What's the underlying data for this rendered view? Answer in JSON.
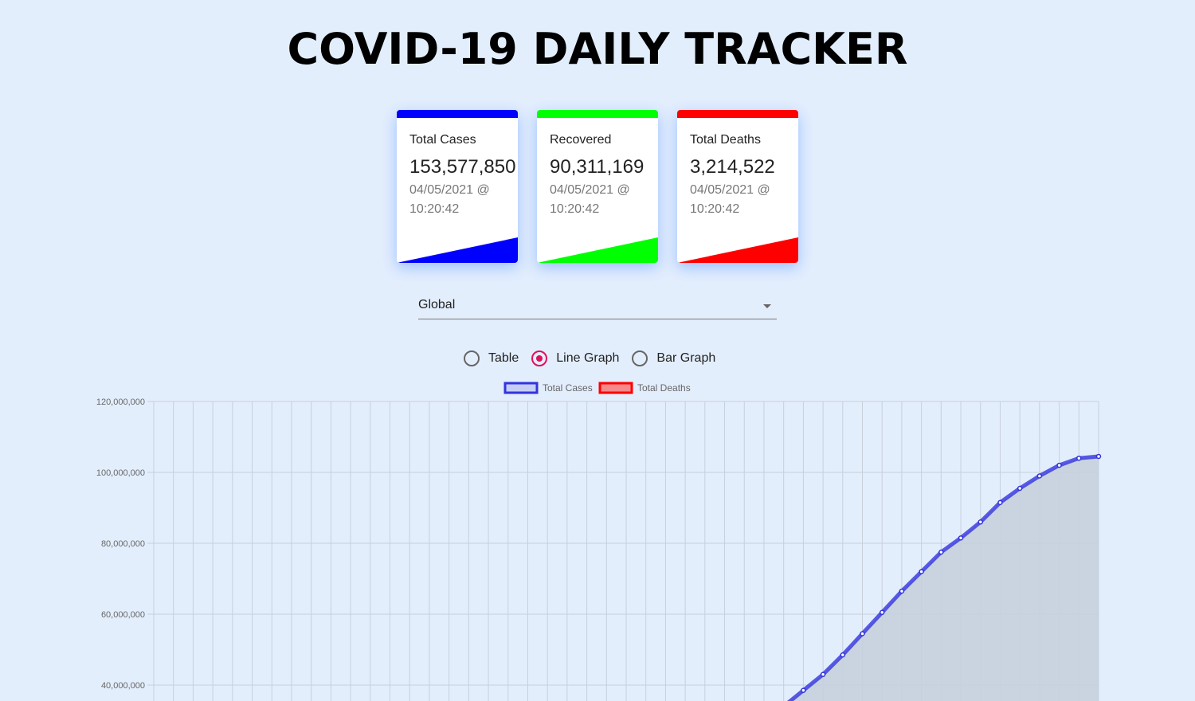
{
  "header": {
    "title": "COVID-19 DAILY TRACKER"
  },
  "cards": [
    {
      "label": "Total Cases",
      "value": "153,577,850",
      "date": "04/05/2021 @",
      "time": "10:20:42",
      "color": "#0000ff"
    },
    {
      "label": "Recovered",
      "value": "90,311,169",
      "date": "04/05/2021 @",
      "time": "10:20:42",
      "color": "#00ff00"
    },
    {
      "label": "Total Deaths",
      "value": "3,214,522",
      "date": "04/05/2021 @",
      "time": "10:20:42",
      "color": "#ff0000"
    }
  ],
  "country_select": {
    "value": "Global",
    "icon": "chevron-down-icon"
  },
  "view_options": {
    "options": [
      "Table",
      "Line Graph",
      "Bar Graph"
    ],
    "selected": "Line Graph",
    "accent": "#e0105a"
  },
  "chart_data": {
    "type": "line",
    "legend": [
      {
        "name": "Total Cases",
        "color": "#3333dd"
      },
      {
        "name": "Total Deaths",
        "color": "#ff0000"
      }
    ],
    "legend_position": "top-center",
    "yticks": [
      "120,000,000",
      "100,000,000",
      "80,000,000",
      "60,000,000",
      "40,000,000"
    ],
    "ylim": [
      40000000,
      120000000
    ],
    "grid": true,
    "series": [
      {
        "name": "Total Cases",
        "color": "#3333dd",
        "fill": "#c5d0dd",
        "points_x_index": [
          32,
          33,
          34,
          35,
          36,
          37,
          38,
          39,
          40,
          41,
          42,
          43,
          44,
          45,
          46,
          47,
          48
        ],
        "values": [
          34000000,
          38500000,
          43000000,
          48500000,
          54500000,
          60500000,
          66500000,
          72000000,
          77500000,
          81500000,
          86000000,
          91500000,
          95500000,
          99000000,
          102000000,
          104000000,
          104500000
        ]
      }
    ],
    "x_count": 48
  }
}
